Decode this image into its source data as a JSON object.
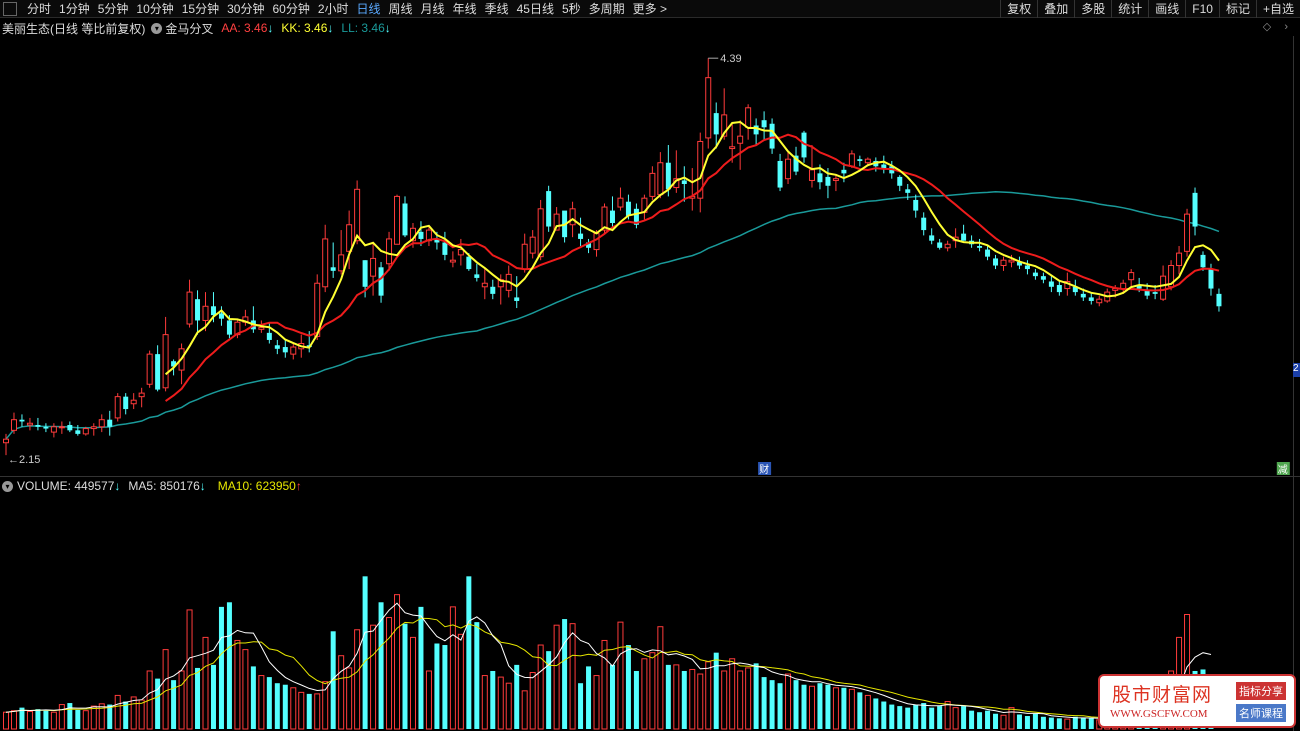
{
  "toolbar": {
    "periods": [
      "分时",
      "1分钟",
      "5分钟",
      "10分钟",
      "15分钟",
      "30分钟",
      "60分钟",
      "2小时",
      "日线",
      "周线",
      "月线",
      "年线",
      "季线",
      "45日线",
      "5秒",
      "多周期",
      "更多 >"
    ],
    "active_period": "日线",
    "tools": [
      "复权",
      "叠加",
      "多股",
      "统计",
      "画线",
      "F10",
      "标记",
      "+自选"
    ]
  },
  "info": {
    "stock": "美丽生态(日线 等比前复权)",
    "indicator_icon": "collapse-icon",
    "indicator": "金马分叉",
    "aa": "AA: 3.46",
    "kk": "KK: 3.46",
    "ll": "LL: 3.46",
    "arrow_down": "↓"
  },
  "price_labels": {
    "high": "4.39",
    "low": "2.15",
    "axis_tag": "2"
  },
  "markers": {
    "cai": "财",
    "jian": "减"
  },
  "volume_info": {
    "icon": "collapse-icon",
    "volume": "VOLUME: 449577",
    "ma5": "MA5: 850176",
    "ma10": "MA10: 623950",
    "arrow_down": "↓",
    "arrow_up": "↑"
  },
  "watermark": {
    "title": "股市财富网",
    "url": "WWW.GSCFW.COM",
    "tag1": "指标分享",
    "tag2": "名师课程"
  },
  "colors": {
    "up": "#ff3b3b",
    "down": "#54ffff",
    "yellow_line": "#ffff33",
    "red_line": "#ee1c1c",
    "teal_line": "#1a9a9a",
    "ma5": "#ffffff",
    "ma10": "#e6e600"
  },
  "chart_data": {
    "type": "candlestick",
    "price_ylim": [
      2.1,
      4.47
    ],
    "volume_ymax": 1500000,
    "candles": [
      [
        2.22,
        2.27,
        2.15,
        2.24
      ],
      [
        2.29,
        2.39,
        2.27,
        2.35
      ],
      [
        2.35,
        2.38,
        2.31,
        2.34
      ],
      [
        2.32,
        2.36,
        2.29,
        2.33
      ],
      [
        2.32,
        2.36,
        2.29,
        2.31
      ],
      [
        2.31,
        2.33,
        2.28,
        2.3
      ],
      [
        2.28,
        2.33,
        2.25,
        2.31
      ],
      [
        2.31,
        2.34,
        2.27,
        2.31
      ],
      [
        2.32,
        2.34,
        2.28,
        2.29
      ],
      [
        2.29,
        2.32,
        2.26,
        2.27
      ],
      [
        2.27,
        2.31,
        2.26,
        2.3
      ],
      [
        2.3,
        2.33,
        2.26,
        2.31
      ],
      [
        2.31,
        2.38,
        2.28,
        2.35
      ],
      [
        2.35,
        2.4,
        2.26,
        2.31
      ],
      [
        2.36,
        2.5,
        2.34,
        2.48
      ],
      [
        2.48,
        2.5,
        2.38,
        2.41
      ],
      [
        2.44,
        2.5,
        2.41,
        2.46
      ],
      [
        2.48,
        2.53,
        2.42,
        2.5
      ],
      [
        2.55,
        2.74,
        2.53,
        2.72
      ],
      [
        2.72,
        2.77,
        2.51,
        2.52
      ],
      [
        2.53,
        2.93,
        2.51,
        2.83
      ],
      [
        2.68,
        2.69,
        2.6,
        2.65
      ],
      [
        2.63,
        2.78,
        2.55,
        2.75
      ],
      [
        2.89,
        3.14,
        2.87,
        3.07
      ],
      [
        3.03,
        3.08,
        2.83,
        2.91
      ],
      [
        2.91,
        3.07,
        2.85,
        2.99
      ],
      [
        2.99,
        3.07,
        2.9,
        2.94
      ],
      [
        2.95,
        2.99,
        2.88,
        2.92
      ],
      [
        2.91,
        2.94,
        2.81,
        2.83
      ],
      [
        2.83,
        2.92,
        2.81,
        2.9
      ],
      [
        2.9,
        2.97,
        2.88,
        2.93
      ],
      [
        2.91,
        2.99,
        2.84,
        2.86
      ],
      [
        2.86,
        2.91,
        2.84,
        2.87
      ],
      [
        2.84,
        2.9,
        2.78,
        2.8
      ],
      [
        2.77,
        2.8,
        2.72,
        2.75
      ],
      [
        2.76,
        2.8,
        2.7,
        2.73
      ],
      [
        2.72,
        2.78,
        2.69,
        2.76
      ],
      [
        2.75,
        2.83,
        2.7,
        2.78
      ],
      [
        2.77,
        2.85,
        2.73,
        2.76
      ],
      [
        2.82,
        3.17,
        2.8,
        3.12
      ],
      [
        3.1,
        3.45,
        3.07,
        3.37
      ],
      [
        3.21,
        3.35,
        3.15,
        3.19
      ],
      [
        3.19,
        3.42,
        3.17,
        3.28
      ],
      [
        3.3,
        3.53,
        3.2,
        3.45
      ],
      [
        3.36,
        3.7,
        3.34,
        3.65
      ],
      [
        3.25,
        3.25,
        3.04,
        3.1
      ],
      [
        3.16,
        3.35,
        3.05,
        3.26
      ],
      [
        3.21,
        3.24,
        3.01,
        3.05
      ],
      [
        3.23,
        3.41,
        3.19,
        3.37
      ],
      [
        3.34,
        3.62,
        3.34,
        3.61
      ],
      [
        3.57,
        3.61,
        3.38,
        3.39
      ],
      [
        3.36,
        3.46,
        3.32,
        3.43
      ],
      [
        3.41,
        3.47,
        3.33,
        3.37
      ],
      [
        3.36,
        3.44,
        3.33,
        3.42
      ],
      [
        3.37,
        3.41,
        3.31,
        3.35
      ],
      [
        3.35,
        3.41,
        3.25,
        3.28
      ],
      [
        3.24,
        3.3,
        3.21,
        3.25
      ],
      [
        3.28,
        3.37,
        3.22,
        3.31
      ],
      [
        3.27,
        3.29,
        3.19,
        3.2
      ],
      [
        3.17,
        3.23,
        3.13,
        3.15
      ],
      [
        3.1,
        3.21,
        3.03,
        3.12
      ],
      [
        3.1,
        3.14,
        3.03,
        3.06
      ],
      [
        3.1,
        3.17,
        3.0,
        3.14
      ],
      [
        3.08,
        3.22,
        3.04,
        3.17
      ],
      [
        3.04,
        3.16,
        2.98,
        3.02
      ],
      [
        3.2,
        3.4,
        3.18,
        3.34
      ],
      [
        3.29,
        3.42,
        3.26,
        3.38
      ],
      [
        3.27,
        3.59,
        3.25,
        3.54
      ],
      [
        3.64,
        3.67,
        3.41,
        3.44
      ],
      [
        3.42,
        3.55,
        3.42,
        3.51
      ],
      [
        3.53,
        3.52,
        3.35,
        3.38
      ],
      [
        3.45,
        3.58,
        3.38,
        3.54
      ],
      [
        3.4,
        3.49,
        3.33,
        3.37
      ],
      [
        3.35,
        3.37,
        3.29,
        3.32
      ],
      [
        3.31,
        3.42,
        3.27,
        3.4
      ],
      [
        3.42,
        3.57,
        3.4,
        3.55
      ],
      [
        3.53,
        3.61,
        3.44,
        3.46
      ],
      [
        3.55,
        3.66,
        3.53,
        3.6
      ],
      [
        3.58,
        3.62,
        3.48,
        3.5
      ],
      [
        3.54,
        3.57,
        3.43,
        3.45
      ],
      [
        3.52,
        3.62,
        3.48,
        3.6
      ],
      [
        3.61,
        3.78,
        3.59,
        3.74
      ],
      [
        3.62,
        3.86,
        3.6,
        3.8
      ],
      [
        3.8,
        3.9,
        3.61,
        3.65
      ],
      [
        3.66,
        3.87,
        3.63,
        3.71
      ],
      [
        3.7,
        3.78,
        3.58,
        3.68
      ],
      [
        3.6,
        3.77,
        3.53,
        3.61
      ],
      [
        3.6,
        3.97,
        3.52,
        3.92
      ],
      [
        3.94,
        4.39,
        3.88,
        4.28
      ],
      [
        4.08,
        4.14,
        3.88,
        3.96
      ],
      [
        3.95,
        4.22,
        3.93,
        4.07
      ],
      [
        3.88,
        4.03,
        3.8,
        3.89
      ],
      [
        3.91,
        4.04,
        3.76,
        3.95
      ],
      [
        4.0,
        4.13,
        3.93,
        4.11
      ],
      [
        4.01,
        4.05,
        3.9,
        3.96
      ],
      [
        4.04,
        4.09,
        3.93,
        4.0
      ],
      [
        4.02,
        4.05,
        3.85,
        3.88
      ],
      [
        3.81,
        3.85,
        3.64,
        3.66
      ],
      [
        3.71,
        3.86,
        3.68,
        3.82
      ],
      [
        3.84,
        3.89,
        3.73,
        3.75
      ],
      [
        3.97,
        3.98,
        3.8,
        3.83
      ],
      [
        3.7,
        3.9,
        3.66,
        3.76
      ],
      [
        3.74,
        3.79,
        3.65,
        3.69
      ],
      [
        3.72,
        3.77,
        3.6,
        3.67
      ],
      [
        3.7,
        3.73,
        3.64,
        3.71
      ],
      [
        3.76,
        3.8,
        3.69,
        3.74
      ],
      [
        3.78,
        3.87,
        3.77,
        3.85
      ],
      [
        3.82,
        3.84,
        3.78,
        3.81
      ],
      [
        3.8,
        3.83,
        3.78,
        3.82
      ],
      [
        3.81,
        3.83,
        3.75,
        3.78
      ],
      [
        3.79,
        3.84,
        3.74,
        3.77
      ],
      [
        3.78,
        3.81,
        3.71,
        3.74
      ],
      [
        3.72,
        3.73,
        3.64,
        3.67
      ],
      [
        3.65,
        3.68,
        3.59,
        3.63
      ],
      [
        3.59,
        3.62,
        3.49,
        3.53
      ],
      [
        3.49,
        3.52,
        3.39,
        3.42
      ],
      [
        3.39,
        3.43,
        3.34,
        3.36
      ],
      [
        3.35,
        3.37,
        3.31,
        3.32
      ],
      [
        3.32,
        3.36,
        3.3,
        3.34
      ],
      [
        3.36,
        3.43,
        3.32,
        3.38
      ],
      [
        3.4,
        3.45,
        3.36,
        3.36
      ],
      [
        3.36,
        3.39,
        3.32,
        3.34
      ],
      [
        3.33,
        3.37,
        3.3,
        3.32
      ],
      [
        3.31,
        3.33,
        3.25,
        3.27
      ],
      [
        3.26,
        3.28,
        3.2,
        3.22
      ],
      [
        3.22,
        3.27,
        3.19,
        3.25
      ],
      [
        3.24,
        3.28,
        3.21,
        3.25
      ],
      [
        3.24,
        3.27,
        3.2,
        3.22
      ],
      [
        3.22,
        3.25,
        3.17,
        3.2
      ],
      [
        3.18,
        3.2,
        3.14,
        3.16
      ],
      [
        3.16,
        3.18,
        3.12,
        3.14
      ],
      [
        3.13,
        3.16,
        3.07,
        3.1
      ],
      [
        3.11,
        3.13,
        3.05,
        3.07
      ],
      [
        3.09,
        3.18,
        3.05,
        3.13
      ],
      [
        3.1,
        3.14,
        3.05,
        3.07
      ],
      [
        3.06,
        3.09,
        3.02,
        3.04
      ],
      [
        3.04,
        3.07,
        3.0,
        3.02
      ],
      [
        3.01,
        3.05,
        2.99,
        3.03
      ],
      [
        3.02,
        3.09,
        3.01,
        3.07
      ],
      [
        3.08,
        3.11,
        3.04,
        3.09
      ],
      [
        3.09,
        3.14,
        3.06,
        3.12
      ],
      [
        3.14,
        3.2,
        3.1,
        3.18
      ],
      [
        3.11,
        3.15,
        3.07,
        3.09
      ],
      [
        3.08,
        3.12,
        3.03,
        3.05
      ],
      [
        3.07,
        3.11,
        3.03,
        3.06
      ],
      [
        3.03,
        3.22,
        3.02,
        3.16
      ],
      [
        3.1,
        3.25,
        3.08,
        3.22
      ],
      [
        3.22,
        3.33,
        3.17,
        3.29
      ],
      [
        3.3,
        3.54,
        3.27,
        3.51
      ],
      [
        3.63,
        3.66,
        3.39,
        3.44
      ],
      [
        3.28,
        3.3,
        3.19,
        3.21
      ],
      [
        3.2,
        3.23,
        3.05,
        3.09
      ],
      [
        3.06,
        3.09,
        2.96,
        2.99
      ]
    ],
    "volume": [
      110000,
      120000,
      140000,
      115000,
      130000,
      120000,
      110000,
      160000,
      170000,
      125000,
      120000,
      150000,
      165000,
      160000,
      220000,
      180000,
      210000,
      190000,
      380000,
      330000,
      520000,
      320000,
      380000,
      780000,
      400000,
      600000,
      420000,
      800000,
      830000,
      580000,
      520000,
      410000,
      350000,
      340000,
      300000,
      290000,
      270000,
      240000,
      230000,
      230000,
      310000,
      640000,
      480000,
      400000,
      650000,
      1000000,
      680000,
      830000,
      730000,
      880000,
      690000,
      600000,
      800000,
      380000,
      560000,
      550000,
      800000,
      620000,
      1000000,
      700000,
      350000,
      380000,
      340000,
      300000,
      420000,
      250000,
      370000,
      550000,
      510000,
      680000,
      720000,
      690000,
      300000,
      410000,
      350000,
      580000,
      420000,
      700000,
      550000,
      380000,
      460000,
      500000,
      670000,
      420000,
      420000,
      380000,
      390000,
      360000,
      440000,
      500000,
      380000,
      460000,
      380000,
      400000,
      430000,
      340000,
      320000,
      300000,
      360000,
      320000,
      290000,
      280000,
      300000,
      290000,
      270000,
      270000,
      260000,
      240000,
      220000,
      200000,
      180000,
      160000,
      150000,
      140000,
      160000,
      170000,
      140000,
      150000,
      180000,
      140000,
      150000,
      120000,
      110000,
      120000,
      100000,
      90000,
      140000,
      95000,
      85000,
      100000,
      80000,
      75000,
      70000,
      65000,
      80000,
      75000,
      70000,
      60000,
      55000,
      70000,
      80000,
      60000,
      55000,
      50000,
      60000,
      240000,
      380000,
      600000,
      750000,
      380000,
      390000,
      320000
    ]
  }
}
